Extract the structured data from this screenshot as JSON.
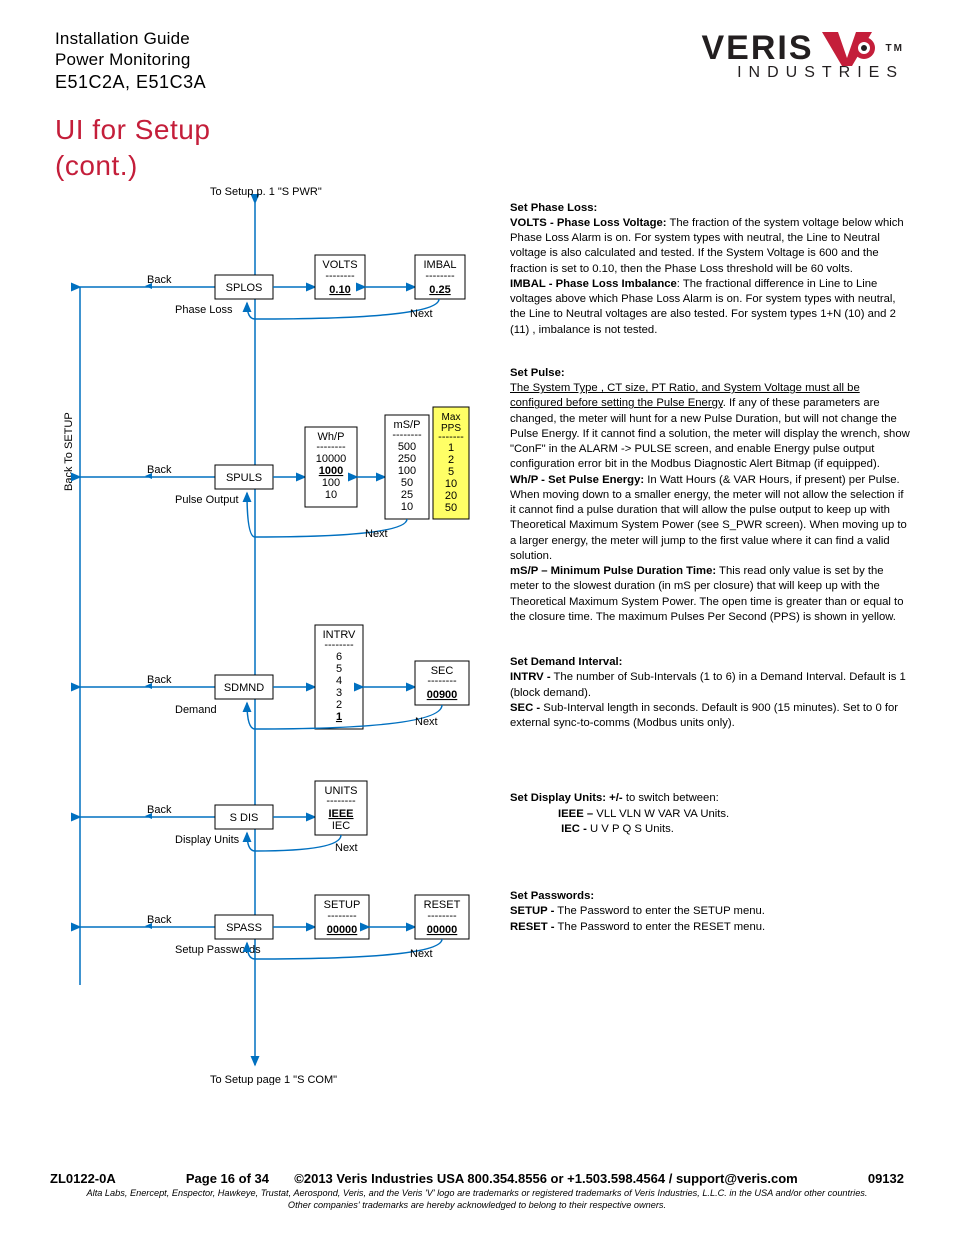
{
  "header": {
    "line1": "Installation Guide",
    "line2": "Power Monitoring",
    "line3": "E51C2A, E51C3A",
    "logo_name": "VERIS",
    "logo_sub": "INDUSTRIES",
    "tm": "TM"
  },
  "title": {
    "line1": "UI for Setup",
    "line2": "(cont.)"
  },
  "diagram": {
    "top_note": "To Setup p. 1 \"S  PWR\"",
    "bottom_note": "To Setup page 1 \"S COM\"",
    "back_to_setup": "Back To  SETUP",
    "back": "Back",
    "next": "Next",
    "splos": {
      "label": "SPLOS",
      "sub": "Phase\nLoss",
      "volts": {
        "h": "VOLTS",
        "v": "0.10"
      },
      "imbal": {
        "h": "IMBAL",
        "v": "0.25"
      }
    },
    "spuls": {
      "label": "SPULS",
      "sub": "Pulse\nOutput",
      "whp": {
        "h": "Wh/P",
        "opts": [
          "10000",
          "1000",
          "100",
          "10"
        ],
        "sel": 1
      },
      "msp": {
        "h": "mS/P",
        "opts": [
          "500",
          "250",
          "100",
          "50",
          "25",
          "10"
        ]
      },
      "pps": {
        "h": "Max PPS",
        "opts": [
          "1",
          "2",
          "5",
          "10",
          "20",
          "50"
        ]
      }
    },
    "sdmnd": {
      "label": "SDMND",
      "sub": "Demand",
      "intrv": {
        "h": "INTRV",
        "opts": [
          "6",
          "5",
          "4",
          "3",
          "2",
          "1"
        ],
        "sel": 5
      },
      "sec": {
        "h": "SEC",
        "v": "00900"
      }
    },
    "sdis": {
      "label": "S DIS",
      "sub": "Display\nUnits",
      "units": {
        "h": "UNITS",
        "opts": [
          "IEEE",
          "IEC"
        ],
        "sel": 0
      }
    },
    "spass": {
      "label": "SPASS",
      "sub": "Setup\nPasswords",
      "setup": {
        "h": "SETUP",
        "v": "00000"
      },
      "reset": {
        "h": "RESET",
        "v": "00000"
      }
    }
  },
  "text": {
    "phaseloss_h": "Set Phase Loss:",
    "phaseloss_p1a": "VOLTS - Phase Loss Voltage:",
    "phaseloss_p1b": " The fraction of the system voltage below which Phase Loss Alarm is on. For system types with neutral, the Line to Neutral voltage is also calculated and tested. If the System Voltage is 600 and the fraction is set to 0.10, then the Phase Loss threshold will be 60 volts.",
    "phaseloss_p2a": "IMBAL - Phase Loss Imbalance",
    "phaseloss_p2b": ": The fractional difference in Line to Line voltages above which Phase Loss Alarm is on. For system types with neutral, the Line to Neutral voltages are also tested. For system types 1+N (10) and 2 (11) , imbalance is not tested.",
    "pulse_h": "Set Pulse:",
    "pulse_u": "The System Type , CT size, PT Ratio, and System Voltage must all be configured before setting the Pulse Energy",
    "pulse_p1": ". If any of these parameters are changed, the meter will hunt for a new Pulse Duration, but will not change the Pulse Energy. If it cannot find a solution, the meter will display the wrench, show \"ConF\" in the ALARM -> PULSE screen, and enable Energy pulse output configuration error bit in the Modbus Diagnostic Alert Bitmap (if equipped).",
    "pulse_p2a": "Wh/P - Set Pulse Energy:",
    "pulse_p2b": " In Watt Hours (& VAR Hours, if present) per Pulse. When moving down to a smaller energy, the meter will not allow the selection if it cannot find a pulse duration that will allow the pulse output to keep up with Theoretical Maximum System Power (see S_PWR screen). When moving up to a larger energy, the meter will jump to the first value where it can find a valid solution.",
    "pulse_p3a": "mS/P – Minimum Pulse Duration Time:",
    "pulse_p3b": " This read only value is set by the meter to the slowest duration (in mS per closure) that will keep up with the Theoretical Maximum System Power. The open time is greater than or equal to the closure time. The maximum Pulses Per Second (PPS) is shown in yellow.",
    "demand_h": "Set Demand Interval:",
    "demand_p1a": "INTRV -",
    "demand_p1b": " The number of Sub-Intervals (1 to 6) in a Demand Interval. Default is 1 (block demand).",
    "demand_p2a": "SEC -",
    "demand_p2b": " Sub-Interval length in seconds. Default is 900 (15 minutes). Set to 0 for external sync-to-comms (Modbus units only).",
    "units_h": "Set Display Units:  +/-",
    "units_t": " to switch between:",
    "units_l1": "IEEE –",
    "units_l1b": " VLL  VLN   W   VAR   VA Units.",
    "units_l2": " IEC   -",
    "units_l2b": "    U     V     P     Q      S  Units.",
    "pass_h": "Set Passwords:",
    "pass_p1a": "SETUP -",
    "pass_p1b": "  The Password to enter the SETUP menu.",
    "pass_p2a": "RESET -",
    "pass_p2b": "  The Password to enter the RESET menu."
  },
  "footer": {
    "left": "ZL0122-0A",
    "page": "Page 16 of 34",
    "copyright": "©2013 Veris Industries   USA 800.354.8556 or +1.503.598.4564  / support@veris.com",
    "right": "09132",
    "trademark1": "Alta Labs, Enercept, Enspector, Hawkeye, Trustat, Aerospond, Veris, and the Veris 'V' logo are trademarks or registered trademarks of  Veris Industries, L.L.C. in the USA and/or other countries.",
    "trademark2": "Other companies' trademarks are hereby acknowledged to belong to their respective owners."
  }
}
